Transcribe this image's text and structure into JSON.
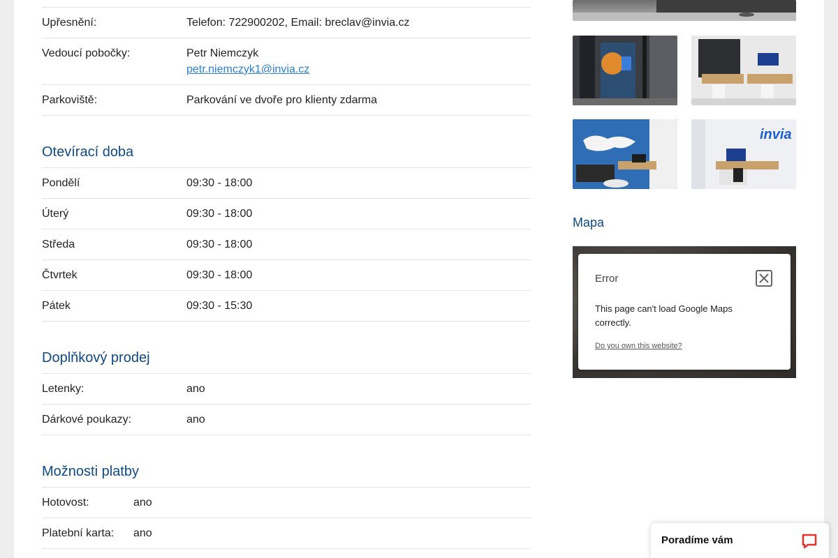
{
  "details": [
    {
      "label": "Upřesnění:",
      "value": "Telefon: 722900202, Email: breclav@invia.cz"
    },
    {
      "label": "Vedoucí pobočky:",
      "value": "Petr Niemczyk",
      "link": "petr.niemczyk1@invia.cz"
    },
    {
      "label": "Parkoviště:",
      "value": "Parkování ve dvoře pro klienty zdarma"
    }
  ],
  "hours": {
    "title": "Otevírací doba",
    "rows": [
      {
        "day": "Pondělí",
        "time": "09:30 - 18:00"
      },
      {
        "day": "Úterý",
        "time": "09:30 - 18:00"
      },
      {
        "day": "Středa",
        "time": "09:30 - 18:00"
      },
      {
        "day": "Čtvrtek",
        "time": "09:30 - 18:00"
      },
      {
        "day": "Pátek",
        "time": "09:30 - 15:30"
      }
    ]
  },
  "extra_sales": {
    "title": "Doplňkový prodej",
    "rows": [
      {
        "label": "Letenky:",
        "value": "ano"
      },
      {
        "label": "Dárkové poukazy:",
        "value": "ano"
      }
    ]
  },
  "payment": {
    "title": "Možnosti platby",
    "rows": [
      {
        "label": "Hotovost:",
        "value": "ano"
      },
      {
        "label": "Platební karta:",
        "value": "ano"
      }
    ]
  },
  "gallery": {
    "logo_text": "invia"
  },
  "map": {
    "title": "Mapa",
    "error_title": "Error",
    "error_message": "This page can't load Google Maps correctly.",
    "error_link": "Do you own this website?"
  },
  "chat": {
    "label": "Poradíme vám"
  },
  "colors": {
    "heading": "#0f4a87",
    "link": "#2a7fd0",
    "brand_blue": "#2f6eb5",
    "chat_icon": "#e8332d"
  }
}
